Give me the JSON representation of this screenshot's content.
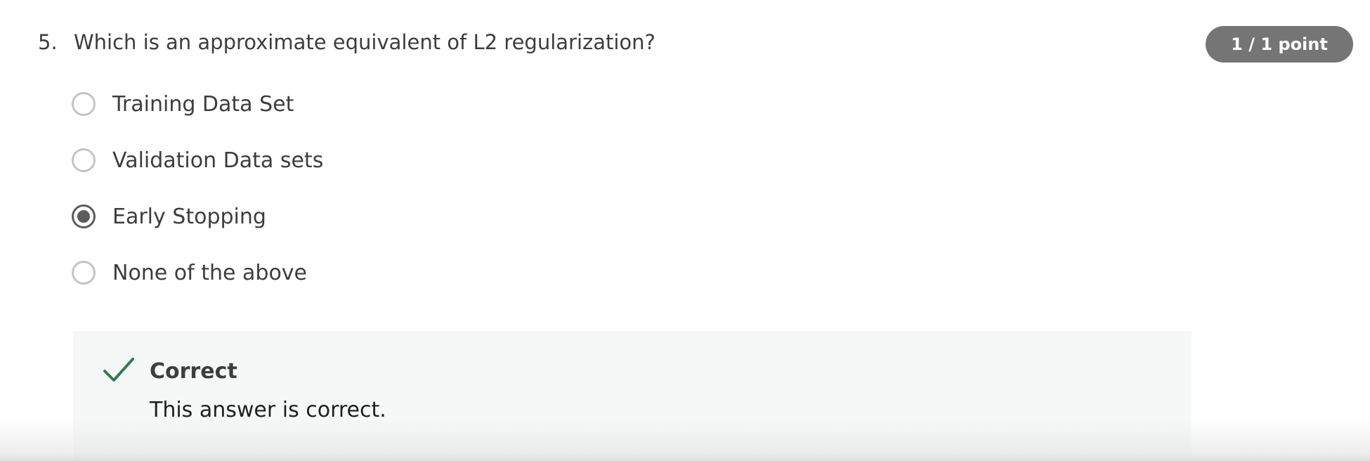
{
  "question": {
    "number": "5.",
    "text": "Which is an approximate equivalent of L2 regularization?",
    "points": "1 / 1 point"
  },
  "options": [
    {
      "label": "Training Data Set",
      "selected": false
    },
    {
      "label": "Validation Data sets",
      "selected": false
    },
    {
      "label": "Early Stopping",
      "selected": true
    },
    {
      "label": "None of the above",
      "selected": false
    }
  ],
  "feedback": {
    "icon": "check-icon",
    "title": "Correct",
    "text": "This answer is correct.",
    "accent_color": "#2e7d52"
  },
  "colors": {
    "badge_bg": "#757575",
    "radio_selected": "#5c5c5c",
    "radio_unselected": "#c4c4c4",
    "feedback_bg": "#f6f8f8"
  }
}
